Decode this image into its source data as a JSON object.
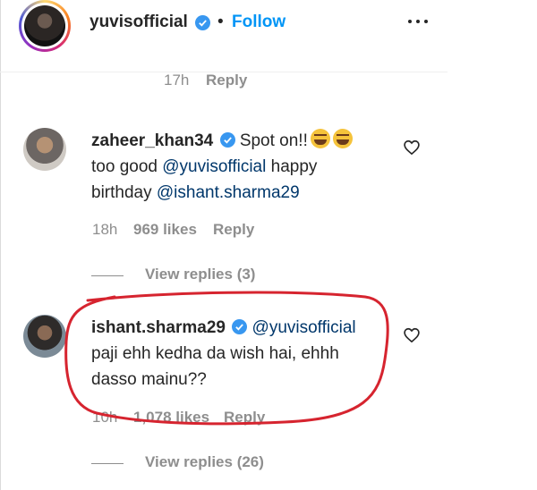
{
  "post_header": {
    "username": "yuvisofficial",
    "separator": "•",
    "follow_label": "Follow"
  },
  "top_meta": {
    "time": "17h",
    "reply_label": "Reply"
  },
  "comments": [
    {
      "username": "zaheer_khan34",
      "text_part1": "Spot on!!",
      "line2_prefix": "too good",
      "mention1": "@yuvisofficial",
      "line2_suffix": "happy",
      "line3_prefix": "birthday",
      "mention2": "@ishant.sharma29",
      "time": "18h",
      "likes": "969 likes",
      "reply_label": "Reply",
      "view_replies": "View replies (3)"
    },
    {
      "username": "ishant.sharma29",
      "mention": "@yuvisofficial",
      "line2": "paji ehh kedha da wish hai, ehhh",
      "line3": "dasso mainu??",
      "time": "10h",
      "likes": "1,078 likes",
      "reply_label": "Reply",
      "view_replies": "View replies (26)"
    }
  ],
  "colors": {
    "accent": "#0095f6",
    "verified": "#3897f0",
    "annotation": "#d6242f"
  },
  "icons": [
    "verified-badge-icon",
    "more-options-icon",
    "heart-icon",
    "laughing-emoji-icon"
  ]
}
